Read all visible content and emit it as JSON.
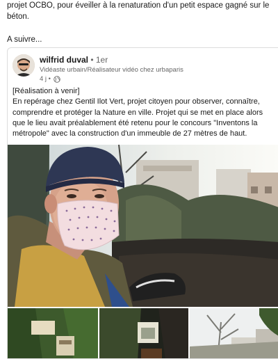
{
  "intro": {
    "line1": "projet OCBO, pour éveiller à la renaturation d'un petit espace gagné sur le",
    "line2": "béton.",
    "follow": "A suivre..."
  },
  "post": {
    "author": "wilfrid duval",
    "degree": " • 1er",
    "headline": "Vidéaste urbain/Réalisateur vidéo chez urbaparis",
    "time": "4 j •",
    "body_lines": [
      "[Réalisation à venir]",
      "En repérage chez Gentil Ilot Vert, projet citoyen pour observer, connaître,",
      "comprendre et protéger la Nature en ville. Projet qui se met en place alors",
      "que le lieu avait préalablement été retenu pour le concours \"Inventons la",
      "métropole\" avec la construction d'un immeuble de 27 mètres de haut."
    ]
  },
  "icons": {
    "visibility": "globe-icon"
  }
}
